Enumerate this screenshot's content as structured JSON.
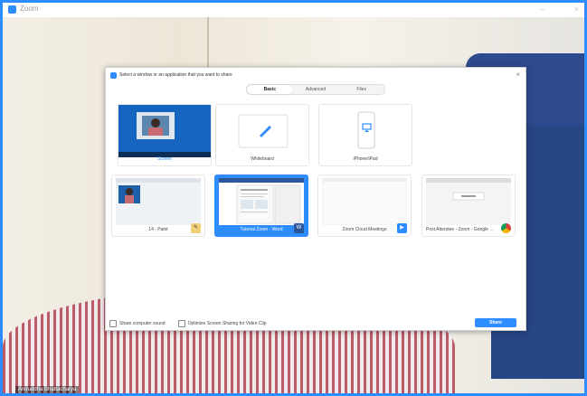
{
  "window": {
    "title": "Zoom",
    "minimize": "–",
    "close": "×"
  },
  "background": {
    "participant_name": "Aniruddha Bhattacharya"
  },
  "dialog": {
    "title": "Select a window or an application that you want to share",
    "close": "×",
    "tabs": [
      "Basic",
      "Advanced",
      "Files"
    ],
    "active_tab": "Basic",
    "tiles": [
      {
        "label": "Screen"
      },
      {
        "label": "Whiteboard"
      },
      {
        "label": "iPhone/iPad"
      },
      {
        "label": "14 - Paint"
      },
      {
        "label": "Tutorial Zoom - Word"
      },
      {
        "label": "Zoom Cloud Meetings"
      },
      {
        "label": "Post Attendee - Zoom - Google ..."
      }
    ],
    "options": {
      "computer_sound": "Share computer sound",
      "optimize_video": "Optimize Screen Sharing for Video Clip"
    },
    "share_button": "Share"
  }
}
